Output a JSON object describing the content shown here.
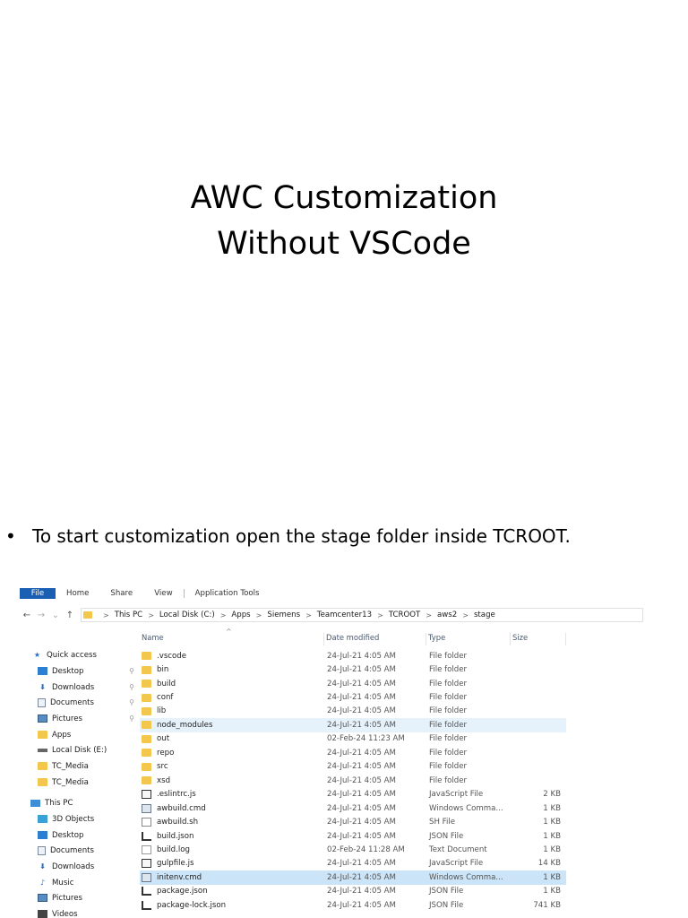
{
  "slide": {
    "title_line1": "AWC Customization",
    "title_line2": "Without VSCode",
    "bullet_symbol": "•",
    "bullet_text": "To start customization open the stage folder inside  TCROOT."
  },
  "explorer": {
    "ribbon_tabs": [
      "File",
      "Home",
      "Share",
      "View",
      "Application Tools"
    ],
    "nav_buttons": {
      "back": "←",
      "forward": "→",
      "recent": "⌄",
      "up": "↑"
    },
    "breadcrumb": [
      "This PC",
      "Local Disk (C:)",
      "Apps",
      "Siemens",
      "Teamcenter13",
      "TCROOT",
      "aws2",
      "stage"
    ],
    "crumb_separator": ">",
    "sort_indicator": "^",
    "columns": {
      "name": "Name",
      "date": "Date modified",
      "type": "Type",
      "size": "Size"
    },
    "nav_items": [
      {
        "label": "Quick access",
        "icon": "star-icon",
        "glyph": "★",
        "pinned": false
      },
      {
        "label": "Desktop",
        "icon": "desktop-icon",
        "glyph": "",
        "pinned": true
      },
      {
        "label": "Downloads",
        "icon": "download-icon",
        "glyph": "⬇",
        "pinned": true
      },
      {
        "label": "Documents",
        "icon": "documents-icon",
        "glyph": "",
        "pinned": true
      },
      {
        "label": "Pictures",
        "icon": "pictures-icon",
        "glyph": "",
        "pinned": true
      },
      {
        "label": "Apps",
        "icon": "folder-icon",
        "glyph": "",
        "pinned": false
      },
      {
        "label": "Local Disk (E:)",
        "icon": "disk-icon",
        "glyph": "",
        "pinned": false
      },
      {
        "label": "TC_Media",
        "icon": "folder-icon",
        "glyph": "",
        "pinned": false
      },
      {
        "label": "TC_Media",
        "icon": "folder-icon",
        "glyph": "",
        "pinned": false
      },
      {
        "label": "This PC",
        "icon": "computer-icon",
        "glyph": "",
        "pinned": false
      },
      {
        "label": "3D Objects",
        "icon": "cube-icon",
        "glyph": "",
        "pinned": false
      },
      {
        "label": "Desktop",
        "icon": "desktop-icon",
        "glyph": "",
        "pinned": false
      },
      {
        "label": "Documents",
        "icon": "documents-icon",
        "glyph": "",
        "pinned": false
      },
      {
        "label": "Downloads",
        "icon": "download-icon",
        "glyph": "⬇",
        "pinned": false
      },
      {
        "label": "Music",
        "icon": "music-icon",
        "glyph": "♪",
        "pinned": false
      },
      {
        "label": "Pictures",
        "icon": "pictures-icon",
        "glyph": "",
        "pinned": false
      },
      {
        "label": "Videos",
        "icon": "video-icon",
        "glyph": "",
        "pinned": false
      }
    ],
    "pin_glyph": "📌",
    "files": [
      {
        "name": ".vscode",
        "date": "24-Jul-21 4:05 AM",
        "type": "File folder",
        "size": "",
        "kind": "folder"
      },
      {
        "name": "bin",
        "date": "24-Jul-21 4:05 AM",
        "type": "File folder",
        "size": "",
        "kind": "folder"
      },
      {
        "name": "build",
        "date": "24-Jul-21 4:05 AM",
        "type": "File folder",
        "size": "",
        "kind": "folder"
      },
      {
        "name": "conf",
        "date": "24-Jul-21 4:05 AM",
        "type": "File folder",
        "size": "",
        "kind": "folder"
      },
      {
        "name": "lib",
        "date": "24-Jul-21 4:05 AM",
        "type": "File folder",
        "size": "",
        "kind": "folder"
      },
      {
        "name": "node_modules",
        "date": "24-Jul-21 4:05 AM",
        "type": "File folder",
        "size": "",
        "kind": "folder",
        "state": "hover"
      },
      {
        "name": "out",
        "date": "02-Feb-24 11:23 AM",
        "type": "File folder",
        "size": "",
        "kind": "folder"
      },
      {
        "name": "repo",
        "date": "24-Jul-21 4:05 AM",
        "type": "File folder",
        "size": "",
        "kind": "folder"
      },
      {
        "name": "src",
        "date": "24-Jul-21 4:05 AM",
        "type": "File folder",
        "size": "",
        "kind": "folder"
      },
      {
        "name": "xsd",
        "date": "24-Jul-21 4:05 AM",
        "type": "File folder",
        "size": "",
        "kind": "folder"
      },
      {
        "name": ".eslintrc.js",
        "date": "24-Jul-21 4:05 AM",
        "type": "JavaScript File",
        "size": "2 KB",
        "kind": "js"
      },
      {
        "name": "awbuild.cmd",
        "date": "24-Jul-21 4:05 AM",
        "type": "Windows Comma...",
        "size": "1 KB",
        "kind": "cmd"
      },
      {
        "name": "awbuild.sh",
        "date": "24-Jul-21 4:05 AM",
        "type": "SH File",
        "size": "1 KB",
        "kind": "sh"
      },
      {
        "name": "build.json",
        "date": "24-Jul-21 4:05 AM",
        "type": "JSON File",
        "size": "1 KB",
        "kind": "json"
      },
      {
        "name": "build.log",
        "date": "02-Feb-24 11:28 AM",
        "type": "Text Document",
        "size": "1 KB",
        "kind": "log"
      },
      {
        "name": "gulpfile.js",
        "date": "24-Jul-21 4:05 AM",
        "type": "JavaScript File",
        "size": "14 KB",
        "kind": "js"
      },
      {
        "name": "initenv.cmd",
        "date": "24-Jul-21 4:05 AM",
        "type": "Windows Comma...",
        "size": "1 KB",
        "kind": "cmd",
        "state": "selected"
      },
      {
        "name": "package.json",
        "date": "24-Jul-21 4:05 AM",
        "type": "JSON File",
        "size": "1 KB",
        "kind": "json"
      },
      {
        "name": "package-lock.json",
        "date": "24-Jul-21 4:05 AM",
        "type": "JSON File",
        "size": "741 KB",
        "kind": "json"
      }
    ]
  }
}
